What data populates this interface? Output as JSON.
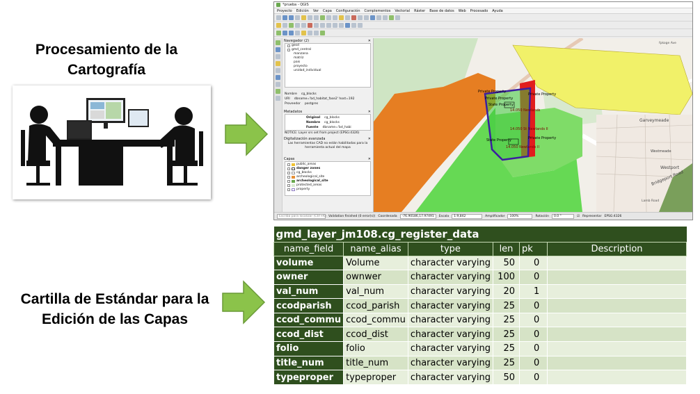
{
  "captions": {
    "processing": "Procesamiento de la Cartografía",
    "standard_card": "Cartilla de Estándar para la Edición de las Capas"
  },
  "qgis": {
    "window_title": "*prueba - QGIS",
    "menu": [
      "Proyecto",
      "Edición",
      "Ver",
      "Capa",
      "Configuración",
      "Complementos",
      "Vectorial",
      "Ráster",
      "Base de datos",
      "Web",
      "Procesado",
      "Ayuda"
    ],
    "navigator": {
      "title": "Navegador (2)",
      "items": [
        "gesd",
        "gmd_central",
        "manzana",
        "matriz",
        "pais",
        "proyecto",
        "unidad_individual"
      ]
    },
    "info": {
      "name_label": "Nombre",
      "name_value": "cg_blocks",
      "uri_label": "URI",
      "uri_value": "dbname='bd_habitat_fase2' host=192",
      "provider_label": "Proveedor",
      "provider_value": "postgres"
    },
    "metadata": {
      "title": "Metadatos",
      "rows": [
        {
          "label": "Original",
          "value": "cg_blocks"
        },
        {
          "label": "Nombre",
          "value": "cg_blocks"
        },
        {
          "label": "Fuente",
          "value": "dbname='bd_habi"
        }
      ],
      "notice": "NOTICE: Layer srs set from project (EPSG:4326)"
    },
    "digitizing": {
      "title": "Digitalización avanzada",
      "message": "Las herramientas CAD no están habilitadas para la herramienta actual del mapa"
    },
    "layers": {
      "title": "Capas",
      "items": [
        {
          "label": "public_areas",
          "color": "#f1c232"
        },
        {
          "label": "danger zones",
          "color": "#ffffff"
        },
        {
          "label": "cg_blocks",
          "color": "#ffffff"
        },
        {
          "label": "archeological_site",
          "color": "#e69138"
        },
        {
          "label": "archeological_site",
          "color": "#6aa84f"
        },
        {
          "label": "protected_areas",
          "color": "#d9ead3"
        },
        {
          "label": "property",
          "color": "#b4a7d6"
        }
      ]
    },
    "map_labels": {
      "private_property_1": "Private Property",
      "private_property_2": "Private Property",
      "private_property_3": "Private Property",
      "state_property": "State Property",
      "private_property_4": "Private Property",
      "state_property_2": "State Property",
      "newlands_1": "14.050 Newlands",
      "newlands_2": "14.050 St Newlands II",
      "newlands_3": "14.050 Newlands II",
      "fpkoge_ave": "fpkoge Ave",
      "garveymeade": "Garveymeade",
      "westmeade": "Westmeade",
      "westport": "Westport",
      "bridgeport_road": "Bridgeport Road",
      "lamb_road": "Lamb Road"
    },
    "status": {
      "search_placeholder": "Escriba para localizar (Ctrl+K)",
      "validation": "Validation finished (0 error(s))",
      "coord_label": "Coordenada",
      "coord_value": "-76.90186,17.97491",
      "scale_label": "Escala",
      "scale_value": "1:9,842",
      "magnifier_label": "Amplificador",
      "magnifier_value": "100%",
      "rotation_label": "Rotación",
      "rotation_value": "0.0 °",
      "render_label": "Representar",
      "crs": "EPSG:4326"
    }
  },
  "table": {
    "title": "gmd_layer_jm108.cg_register_data",
    "headers": [
      "name_field",
      "name_alias",
      "type",
      "len",
      "pk",
      "Description"
    ],
    "rows": [
      {
        "name_field": "volume",
        "name_alias": "Volume",
        "type": "character varying",
        "len": "50",
        "pk": "0",
        "description": ""
      },
      {
        "name_field": "owner",
        "name_alias": "ownwer",
        "type": "character varying",
        "len": "100",
        "pk": "0",
        "description": ""
      },
      {
        "name_field": "val_num",
        "name_alias": "val_num",
        "type": "character varying",
        "len": "20",
        "pk": "1",
        "description": ""
      },
      {
        "name_field": "ccodparish",
        "name_alias": "ccod_parish",
        "type": "character varying",
        "len": "25",
        "pk": "0",
        "description": ""
      },
      {
        "name_field": "ccod_commu",
        "name_alias": "ccod_commu",
        "type": "character varying",
        "len": "25",
        "pk": "0",
        "description": ""
      },
      {
        "name_field": "ccod_dist",
        "name_alias": "ccod_dist",
        "type": "character varying",
        "len": "25",
        "pk": "0",
        "description": ""
      },
      {
        "name_field": "folio",
        "name_alias": "folio",
        "type": "character varying",
        "len": "25",
        "pk": "0",
        "description": ""
      },
      {
        "name_field": "title_num",
        "name_alias": "title_num",
        "type": "character varying",
        "len": "25",
        "pk": "0",
        "description": ""
      },
      {
        "name_field": "typeproper",
        "name_alias": "typeproper",
        "type": "character varying",
        "len": "50",
        "pk": "0",
        "description": ""
      }
    ]
  },
  "colors": {
    "arrow_green": "#8bc34a",
    "table_header": "#2f4f1e",
    "row_light": "#e7efdc",
    "row_dark": "#d6e3c6"
  }
}
